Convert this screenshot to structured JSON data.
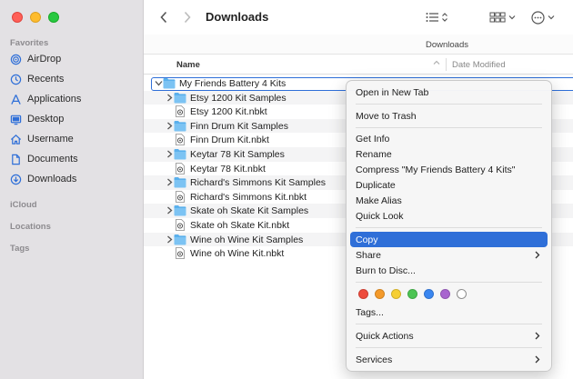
{
  "window": {
    "title": "Downloads",
    "path_title": "Downloads"
  },
  "sidebar": {
    "favorites_header": "Favorites",
    "items": [
      {
        "label": "AirDrop",
        "icon": "airdrop-icon"
      },
      {
        "label": "Recents",
        "icon": "clock-icon"
      },
      {
        "label": "Applications",
        "icon": "applications-icon"
      },
      {
        "label": "Desktop",
        "icon": "desktop-icon"
      },
      {
        "label": "Username",
        "icon": "home-icon"
      },
      {
        "label": "Documents",
        "icon": "document-icon"
      },
      {
        "label": "Downloads",
        "icon": "download-icon"
      }
    ],
    "icloud_header": "iCloud",
    "locations_header": "Locations",
    "tags_header": "Tags"
  },
  "columns": {
    "name": "Name",
    "date": "Date Modified"
  },
  "files": [
    {
      "label": "My Friends Battery 4 Kits",
      "type": "folder",
      "expanded": true,
      "indent": 0,
      "selected": true
    },
    {
      "label": "Etsy 1200 Kit Samples",
      "type": "folder",
      "expanded": false,
      "indent": 1
    },
    {
      "label": "Etsy 1200 Kit.nbkt",
      "type": "file",
      "indent": 1
    },
    {
      "label": "Finn Drum Kit Samples",
      "type": "folder",
      "expanded": false,
      "indent": 1
    },
    {
      "label": "Finn Drum Kit.nbkt",
      "type": "file",
      "indent": 1
    },
    {
      "label": "Keytar 78 Kit Samples",
      "type": "folder",
      "expanded": false,
      "indent": 1
    },
    {
      "label": "Keytar 78 Kit.nbkt",
      "type": "file",
      "indent": 1
    },
    {
      "label": "Richard's Simmons Kit Samples",
      "type": "folder",
      "expanded": false,
      "indent": 1
    },
    {
      "label": "Richard's Simmons Kit.nbkt",
      "type": "file",
      "indent": 1
    },
    {
      "label": "Skate oh Skate Kit Samples",
      "type": "folder",
      "expanded": false,
      "indent": 1
    },
    {
      "label": "Skate oh Skate Kit.nbkt",
      "type": "file",
      "indent": 1
    },
    {
      "label": "Wine oh Wine Kit Samples",
      "type": "folder",
      "expanded": false,
      "indent": 1
    },
    {
      "label": "Wine oh Wine Kit.nbkt",
      "type": "file",
      "indent": 1
    }
  ],
  "context_menu": {
    "open_new_tab": "Open in New Tab",
    "move_to_trash": "Move to Trash",
    "get_info": "Get Info",
    "rename": "Rename",
    "compress": "Compress \"My Friends Battery 4 Kits\"",
    "duplicate": "Duplicate",
    "make_alias": "Make Alias",
    "quick_look": "Quick Look",
    "copy": "Copy",
    "share": "Share",
    "burn": "Burn to Disc...",
    "tags": "Tags...",
    "quick_actions": "Quick Actions",
    "services": "Services",
    "highlighted": "Copy"
  },
  "tag_colors": [
    "#ee4b3c",
    "#f49a2a",
    "#f6cf33",
    "#4cc453",
    "#3a86f0",
    "#a865cf",
    "#ffffff"
  ],
  "accent": "#2f6fd8"
}
